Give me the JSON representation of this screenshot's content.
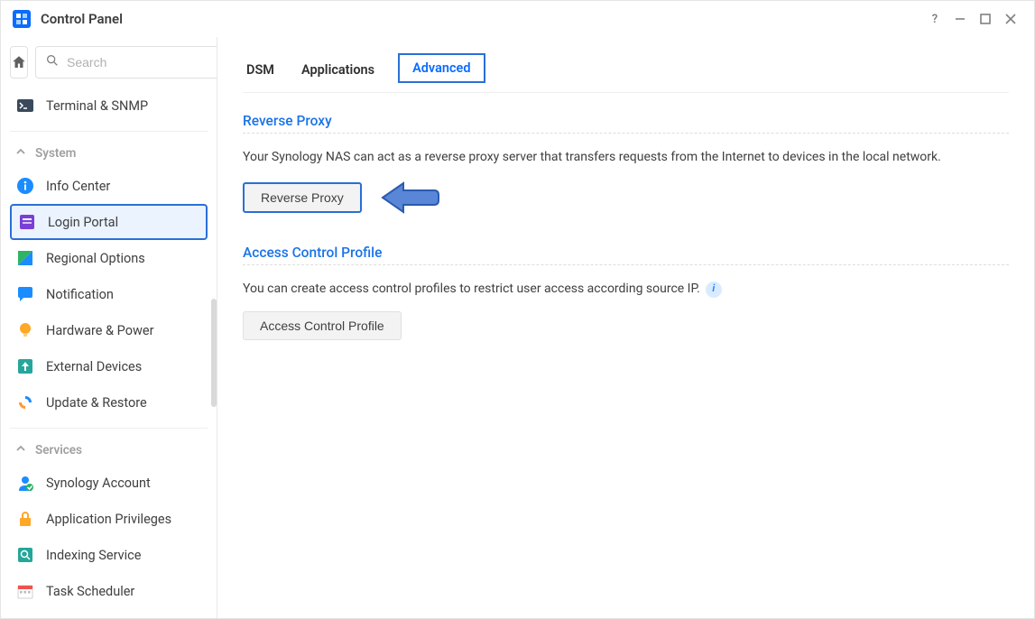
{
  "window": {
    "title": "Control Panel"
  },
  "search": {
    "placeholder": "Search"
  },
  "sidebar": {
    "top_item": {
      "label": "Terminal & SNMP"
    },
    "groups": [
      {
        "name": "System",
        "items": [
          {
            "label": "Info Center"
          },
          {
            "label": "Login Portal"
          },
          {
            "label": "Regional Options"
          },
          {
            "label": "Notification"
          },
          {
            "label": "Hardware & Power"
          },
          {
            "label": "External Devices"
          },
          {
            "label": "Update & Restore"
          }
        ]
      },
      {
        "name": "Services",
        "items": [
          {
            "label": "Synology Account"
          },
          {
            "label": "Application Privileges"
          },
          {
            "label": "Indexing Service"
          },
          {
            "label": "Task Scheduler"
          }
        ]
      }
    ]
  },
  "tabs": [
    {
      "label": "DSM"
    },
    {
      "label": "Applications"
    },
    {
      "label": "Advanced"
    }
  ],
  "sections": {
    "reverse_proxy": {
      "title": "Reverse Proxy",
      "desc": "Your Synology NAS can act as a reverse proxy server that transfers requests from the Internet to devices in the local network.",
      "button": "Reverse Proxy"
    },
    "access_control": {
      "title": "Access Control Profile",
      "desc": "You can create access control profiles to restrict user access according source IP.",
      "button": "Access Control Profile"
    }
  }
}
